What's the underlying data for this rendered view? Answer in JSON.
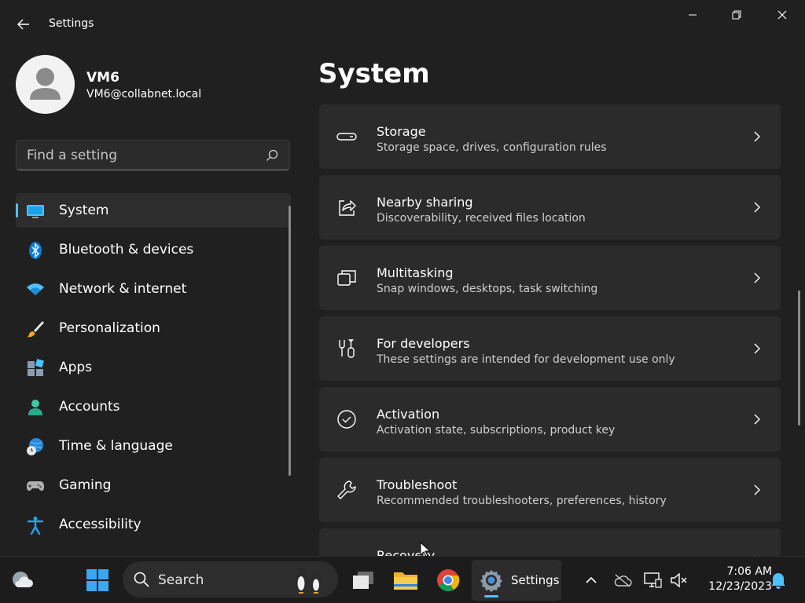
{
  "window": {
    "title": "Settings"
  },
  "profile": {
    "name": "VM6",
    "email": "VM6@collabnet.local"
  },
  "search": {
    "placeholder": "Find a setting"
  },
  "nav": {
    "items": [
      {
        "label": "System",
        "icon": "monitor-icon",
        "active": true
      },
      {
        "label": "Bluetooth & devices",
        "icon": "bluetooth-icon"
      },
      {
        "label": "Network & internet",
        "icon": "wifi-icon"
      },
      {
        "label": "Personalization",
        "icon": "brush-icon"
      },
      {
        "label": "Apps",
        "icon": "apps-icon"
      },
      {
        "label": "Accounts",
        "icon": "person-icon"
      },
      {
        "label": "Time & language",
        "icon": "globe-clock-icon"
      },
      {
        "label": "Gaming",
        "icon": "gamepad-icon"
      },
      {
        "label": "Accessibility",
        "icon": "accessibility-icon"
      }
    ]
  },
  "page": {
    "title": "System"
  },
  "cards": [
    {
      "title": "Storage",
      "subtitle": "Storage space, drives, configuration rules",
      "icon": "storage-drive-icon"
    },
    {
      "title": "Nearby sharing",
      "subtitle": "Discoverability, received files location",
      "icon": "share-icon"
    },
    {
      "title": "Multitasking",
      "subtitle": "Snap windows, desktops, task switching",
      "icon": "multitasking-icon"
    },
    {
      "title": "For developers",
      "subtitle": "These settings are intended for development use only",
      "icon": "developer-tools-icon"
    },
    {
      "title": "Activation",
      "subtitle": "Activation state, subscriptions, product key",
      "icon": "check-circle-icon"
    },
    {
      "title": "Troubleshoot",
      "subtitle": "Recommended troubleshooters, preferences, history",
      "icon": "wrench-icon"
    },
    {
      "title": "Recovery",
      "subtitle": "",
      "icon": "recovery-icon"
    }
  ],
  "taskbar": {
    "search_label": "Search",
    "settings_label": "Settings",
    "time": "7:06 AM",
    "date": "12/23/2023"
  },
  "colors": {
    "accent": "#4cc2ff",
    "background": "#202020",
    "card": "#2b2b2b"
  }
}
